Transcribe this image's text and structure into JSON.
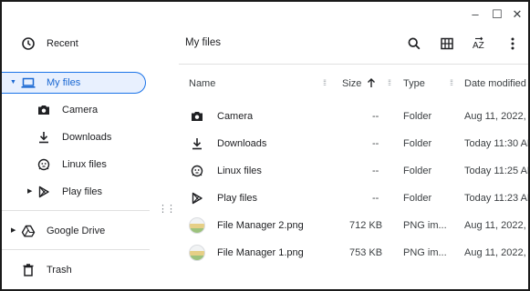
{
  "window": {
    "minimize_glyph": "–",
    "maximize_glyph": "☐",
    "close_glyph": "✕"
  },
  "sidebar": {
    "recent": {
      "label": "Recent",
      "icon": "clock-icon"
    },
    "my_files": {
      "label": "My files",
      "icon": "laptop-icon",
      "expanded": true,
      "selected": true,
      "children": [
        {
          "label": "Camera",
          "icon": "camera-icon"
        },
        {
          "label": "Downloads",
          "icon": "download-icon"
        },
        {
          "label": "Linux files",
          "icon": "penguin-icon"
        },
        {
          "label": "Play files",
          "icon": "play-store-icon",
          "expandable": true
        }
      ]
    },
    "google_drive": {
      "label": "Google Drive",
      "icon": "drive-icon"
    },
    "trash": {
      "label": "Trash",
      "icon": "trash-icon"
    }
  },
  "main": {
    "title": "My files",
    "toolbar": {
      "search_icon": "search-icon",
      "grid_icon": "grid-view-icon",
      "sort_icon": "sort-az-icon",
      "more_icon": "more-vert-icon"
    },
    "columns": {
      "name": "Name",
      "size": "Size",
      "type": "Type",
      "date": "Date modified",
      "sorted_by": "Size",
      "sort_dir": "ascending"
    },
    "rows": [
      {
        "name": "Camera",
        "icon": "camera-icon",
        "size": "--",
        "type": "Folder",
        "date": "Aug 11, 2022, ..."
      },
      {
        "name": "Downloads",
        "icon": "download-icon",
        "size": "--",
        "type": "Folder",
        "date": "Today 11:30 AM"
      },
      {
        "name": "Linux files",
        "icon": "penguin-icon",
        "size": "--",
        "type": "Folder",
        "date": "Today 11:25 AM"
      },
      {
        "name": "Play files",
        "icon": "play-store-icon",
        "size": "--",
        "type": "Folder",
        "date": "Today 11:23 AM"
      },
      {
        "name": "File Manager 2.png",
        "icon": "image-thumbnail",
        "size": "712 KB",
        "type": "PNG im...",
        "date": "Aug 11, 2022, ..."
      },
      {
        "name": "File Manager 1.png",
        "icon": "image-thumbnail",
        "size": "753 KB",
        "type": "PNG im...",
        "date": "Aug 11, 2022, ..."
      }
    ]
  },
  "colors": {
    "accent": "#1a73e8",
    "selected_bg": "#e8f0fe",
    "text": "#202124",
    "secondary_text": "#3c4043",
    "divider": "#e0e0e0"
  }
}
